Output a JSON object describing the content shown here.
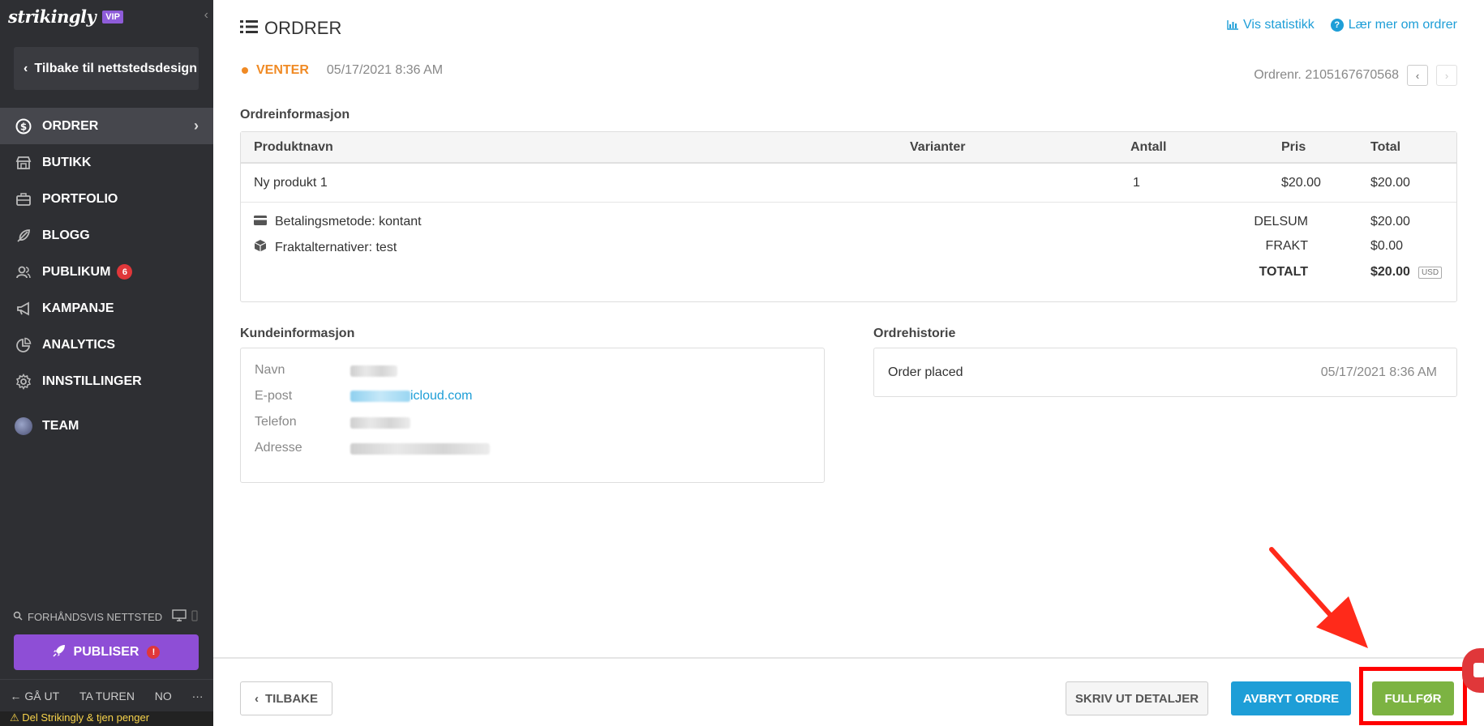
{
  "sidebar": {
    "brand": "strikingly",
    "vip": "VIP",
    "back_label": "Tilbake til nettstedsdesign",
    "items": [
      {
        "label": "ORDRER",
        "icon": "dollar-icon"
      },
      {
        "label": "BUTIKK",
        "icon": "store-icon"
      },
      {
        "label": "PORTFOLIO",
        "icon": "briefcase-icon"
      },
      {
        "label": "BLOGG",
        "icon": "feather-icon"
      },
      {
        "label": "PUBLIKUM",
        "icon": "users-icon",
        "badge": "6"
      },
      {
        "label": "KAMPANJE",
        "icon": "megaphone-icon"
      },
      {
        "label": "ANALYTICS",
        "icon": "pie-chart-icon"
      },
      {
        "label": "INNSTILLINGER",
        "icon": "gear-icon"
      },
      {
        "label": "TEAM",
        "icon": "team-avatar"
      }
    ],
    "preview_label": "FORHÅNDSVIS NETTSTED",
    "publish_label": "PUBLISER",
    "publish_alert": "!",
    "footer": {
      "exit": "GÅ UT",
      "tour": "TA TUREN",
      "lang": "NO",
      "more": "···"
    },
    "banner": "⚠ Del Strikingly & tjen penger"
  },
  "header": {
    "title": "ORDRER",
    "stats_link": "Vis statistikk",
    "learn_link": "Lær mer om ordrer"
  },
  "order": {
    "status": "VENTER",
    "date": "05/17/2021 8:36 AM",
    "number_label": "Ordrenr. 2105167670568",
    "status_color": "#f08a24"
  },
  "order_info": {
    "title": "Ordreinformasjon",
    "columns": [
      "Produktnavn",
      "Varianter",
      "Antall",
      "Pris",
      "Total"
    ],
    "rows": [
      {
        "name": "Ny produkt 1",
        "variants": "",
        "qty": "1",
        "price": "$20.00",
        "total": "$20.00"
      }
    ],
    "payment": "Betalingsmetode: kontant",
    "shipping": "Fraktalternativer: test",
    "subtotal_label": "DELSUM",
    "subtotal": "$20.00",
    "freight_label": "FRAKT",
    "freight": "$0.00",
    "total_label": "TOTALT",
    "total": "$20.00",
    "currency": "USD"
  },
  "customer": {
    "title": "Kundeinformasjon",
    "name_label": "Navn",
    "email_label": "E-post",
    "email_suffix": "icloud.com",
    "phone_label": "Telefon",
    "address_label": "Adresse"
  },
  "history": {
    "title": "Ordrehistorie",
    "entry": "Order placed",
    "time": "05/17/2021 8:36 AM"
  },
  "footer": {
    "back": "TILBAKE",
    "print": "SKRIV UT DETALJER",
    "cancel": "AVBRYT ORDRE",
    "finish": "FULLFØR"
  },
  "colors": {
    "sidebar": "#2e2f33",
    "accent_blue": "#1e9ed7",
    "finish_green": "#7cb342",
    "publish_purple": "#8e4ed6",
    "annotation_red": "#ff0000"
  }
}
